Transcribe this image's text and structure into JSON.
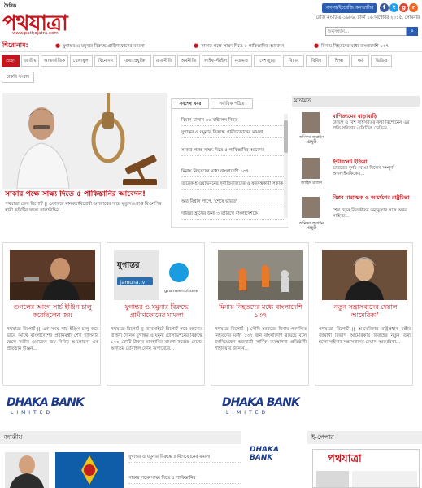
{
  "header": {
    "logo_small": "দৈনিক",
    "logo_big": "পথযাত্রা",
    "logo_url": "www.pathojatra.com",
    "converter_label": "বাংলা/ইংরেজি কনভার্টার",
    "social": [
      {
        "name": "facebook-icon",
        "glyph": "f",
        "color": "#3b5998"
      },
      {
        "name": "twitter-icon",
        "glyph": "t",
        "color": "#1da1f2"
      },
      {
        "name": "google-plus-icon",
        "glyph": "g",
        "color": "#dd4b39"
      },
      {
        "name": "rss-icon",
        "glyph": "r",
        "color": "#f26522"
      }
    ],
    "reg_line": "রেজি নং-ডিএ-১৬৮৬, ঢাকা ১৬ অক্টোবর ২০১৫, সোমবার",
    "search_placeholder": "অনুসন্ধান..."
  },
  "ticker": {
    "label": "শিরোনাম:",
    "items": [
      "যুগান্তর ও যমুনার বিরুদ্ধে গ্রামীণফোনের মামলা",
      "সাকার পক্ষে সাক্ষ্য দিতে ৫ পাকিস্তানির আবেদন",
      "মিনায় নিহতদের মধ্যে বাংলাদেশি ১৩৭"
    ]
  },
  "nav": {
    "items": [
      "প্রচ্ছদ",
      "জাতীয়",
      "আন্তর্জাতিক",
      "খেলাধুলা",
      "বিনোদন",
      "তথ্য প্রযুক্তি",
      "রাজনীতি",
      "অর্থনীতি",
      "লাইফ স্টাইল",
      "মতামত",
      "দেশজুড়ে",
      "বিচার",
      "বিবিধ",
      "শিক্ষা",
      "ধর্ম",
      "ভিডিও",
      "চাকরি সংবাদ"
    ]
  },
  "hero": {
    "title": "সাকার পক্ষে সাক্ষ্য দিতে ৫ পাকিস্তানির আবেদন!",
    "desc": "পথযাত্রা ডেস্ক রিপোর্ট || একাত্তরে মানবতাবিরোধী অপরাধের দায়ে মৃত্যুদণ্ডপ্রাপ্ত বিএনপির স্থায়ী কমিটির সদস্য সালাউদ্দিন..."
  },
  "tabs": {
    "labels": [
      "সর্বশেষ খবর",
      "সর্বাধিক পঠিত"
    ],
    "items": [
      "বিমান চালান ৫০ মাইলেস নিহত",
      "যুগান্তর ও যমুনার বিরুদ্ধে গ্রামীণফোনের মামলা",
      "সাকার পক্ষে সাক্ষ্য দিতে ৫ পাকিস্তানির আবেদন",
      "মিনায় নিহতদের মধ্যে বাংলাদেশি ১৩৭",
      "তারেক-হাওয়াভবনের দুর্নীতিবাজদের ও ষড়যন্ত্রকারী সকাক",
      "অত বিশ্বাস পাপে, 'শেষে ভারত'",
      "দারিদ্র্য হ্রাসের জন্য ৩ তারিখে বাংলাদেশকে"
    ]
  },
  "opinion": {
    "heading": "মতামত",
    "items": [
      {
        "title": "বাণিজ্যমের বাড়াবাড়ি",
        "author": "অনিন্দ্য জুরাইন চৌধুরী",
        "desc": "উদ্বেগ ও বিশ সাহসরতর কথা বিশোনেন এর প্রতি সরিতার এসিডিক ডেভিড..."
      },
      {
        "title": "ইন্টারনেট ইন্ডিয়া",
        "author": "জাহিদ রাজন",
        "desc": "ভারতের দুর্গম বোঙা দিলেন সম্পূর্ণ অনলাইনকিকের..."
      },
      {
        "title": "বিপ্লব মারাত্মক ও আর্ষেণের রাষ্ট্রচিন্তা",
        "author": "অনিন্দ্য জুরাইন চৌধুরী",
        "desc": "শেখ নতুন বিতর্কাতর অনুভূতার সঙ্গে অন্তর সাহিত্য..."
      }
    ]
  },
  "cards": [
    {
      "title": "গুগলের আগে সার্চ ইঞ্জিন চালু করেছিলেন জয়",
      "desc": "পথযাত্রা রিপোর্ট || এক সময় সার্চ ইঞ্জিন চালু করে ভাবে আর্থে বাংলাদেশের প্রধানমন্ত্রী শেখ হাসিনার ছেলে সজীব ওয়াজেদ জয় নিবিড় আলোচনা এক প্রতিষ্ঠান ইঞ্জিন..."
    },
    {
      "title": "যুগান্তর ও যমুনার বিরুদ্ধে গ্রামীণফোনের মামলা",
      "desc": "পথযাত্রা রিপোর্ট || ব্যাবসাইটে রিপোর্ট করে মন্তব্যের বাহিনী দৈনিক যুগান্তর ও যমুনা টেলিভিশনের বিরুদ্ধে ১০০ কোটি টাকার মানহানির মামলা করেছে দেশের অন্যতম মোবাইল ফোন অপারেটর..."
    },
    {
      "title": "মিনায় নিহতদের মধ্যে বাংলাদেশি ১৩৭",
      "desc": "পথযাত্রা রিপোর্ট || সৌদি আরবের মিনায় পদদলিত নিহতদের মধ্যে ১৩৭ জন বাংলাদেশি রয়েছে বলে জানিয়েছেন হজযাত্রী সার্বিক ব্যবস্থাপনা প্রতিষ্ঠানী শাহরিয়ার জানান..."
    },
    {
      "title": "'নতুন সন্ত্রাসবাদের দেয়াল আমেরিকা'",
      "desc": "পথযাত্রা রিপোর্ট || আমেরিকার রাষ্ট্রপ্রধান মন্ত্রীর জার্মানী বিভাগ আমেরিকায় বিবাহের নতুন তথ্য হলো সাইবার-সন্ত্রাসবাদের দেয়াল আমেরিকা..."
    }
  ],
  "ads": {
    "bank": "DHAKA BANK",
    "ltd": "LIMITED"
  },
  "bottom": {
    "national": "জাতীয়",
    "epaper": "ই-পেপার",
    "national_items": [
      "যুগান্তর ও যমুনার বিরুদ্ধে গ্রামীণফোনের মামলা",
      "সাকার পক্ষে সাক্ষ্য দিতে ৫ পাকিস্তানির"
    ]
  }
}
